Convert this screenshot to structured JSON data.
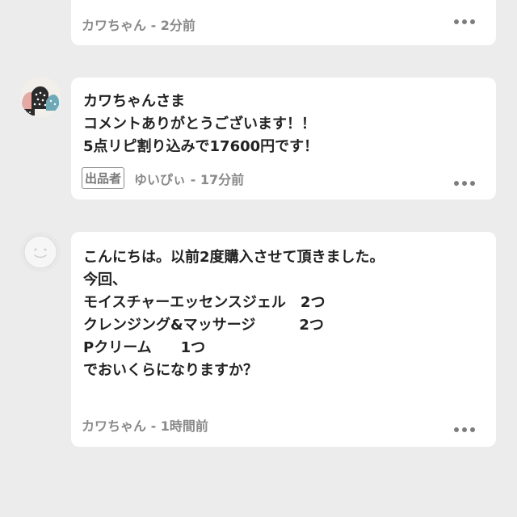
{
  "comments": [
    {
      "author": "カワちゃん",
      "time": "2分前",
      "message": ""
    },
    {
      "author": "ゆいぴぃ",
      "time": "17分前",
      "badge": "出品者",
      "message": "カワちゃんさま\nコメントありがとうございます！！\n5点リピ割り込みで17600円です！"
    },
    {
      "author": "カワちゃん",
      "time": "1時間前",
      "message": "こんにちは。以前2度購入させて頂きました。\n今回、\nモイスチャーエッセンスジェル　2つ\nクレンジング&マッサージ　　　2つ\nPクリーム　　1つ\nでおいくらになりますか？"
    }
  ],
  "separator": " - ",
  "icons": {
    "more": "more-dots-icon",
    "avatar_seller": "seller-avatar-image",
    "avatar_default": "default-avatar-icon"
  },
  "colors": {
    "background": "#ececec",
    "card": "#ffffff",
    "text": "#222222",
    "meta": "#8a8a8a"
  }
}
